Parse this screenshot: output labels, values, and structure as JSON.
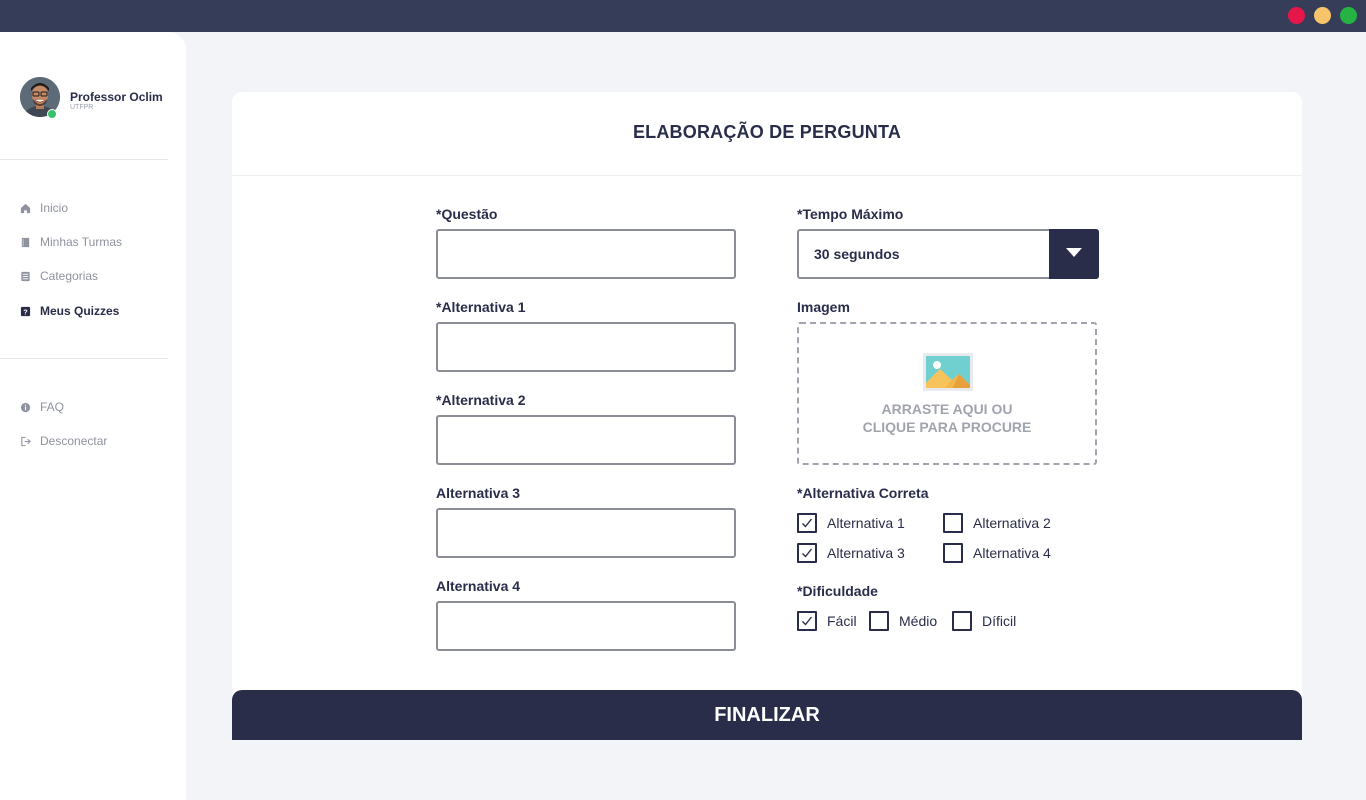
{
  "colors": {
    "titlebar": "#363d58",
    "window_close": "#e5164a",
    "window_minimize": "#f8c46b",
    "window_maximize": "#27b344",
    "primary": "#2a2d4a",
    "online": "#35c06a"
  },
  "profile": {
    "name": "Professor Oclim",
    "org": "UTFPR",
    "status": "online"
  },
  "nav": {
    "items": [
      {
        "label": "Inicio",
        "icon": "home-icon"
      },
      {
        "label": "Minhas Turmas",
        "icon": "book-icon"
      },
      {
        "label": "Categorias",
        "icon": "list-icon"
      },
      {
        "label": "Meus Quizzes",
        "icon": "quiz-icon",
        "active": true
      }
    ],
    "secondary": [
      {
        "label": "FAQ",
        "icon": "info-icon"
      },
      {
        "label": "Desconectar",
        "icon": "logout-icon"
      }
    ]
  },
  "form": {
    "title": "ELABORAÇÃO DE PERGUNTA",
    "fields": {
      "question": {
        "label": "*Questão",
        "value": ""
      },
      "alt1": {
        "label": "*Alternativa 1",
        "value": ""
      },
      "alt2": {
        "label": "*Alternativa 2",
        "value": ""
      },
      "alt3": {
        "label": "Alternativa 3",
        "value": ""
      },
      "alt4": {
        "label": "Alternativa 4",
        "value": ""
      }
    },
    "max_time": {
      "label": "*Tempo Máximo",
      "value": "30 segundos"
    },
    "image": {
      "label": "Imagem",
      "line1": "ARRASTE AQUI OU",
      "line2": "CLIQUE PARA PROCURE"
    },
    "correct": {
      "label": "*Alternativa Correta",
      "options": [
        {
          "label": "Alternativa 1",
          "checked": true
        },
        {
          "label": "Alternativa 2",
          "checked": false
        },
        {
          "label": "Alternativa 3",
          "checked": true
        },
        {
          "label": "Alternativa 4",
          "checked": false
        }
      ]
    },
    "difficulty": {
      "label": "*Dificuldade",
      "options": [
        {
          "label": "Fácil",
          "checked": true
        },
        {
          "label": "Médio",
          "checked": false
        },
        {
          "label": "Díficil",
          "checked": false
        }
      ]
    },
    "submit_label": "FINALIZAR"
  }
}
